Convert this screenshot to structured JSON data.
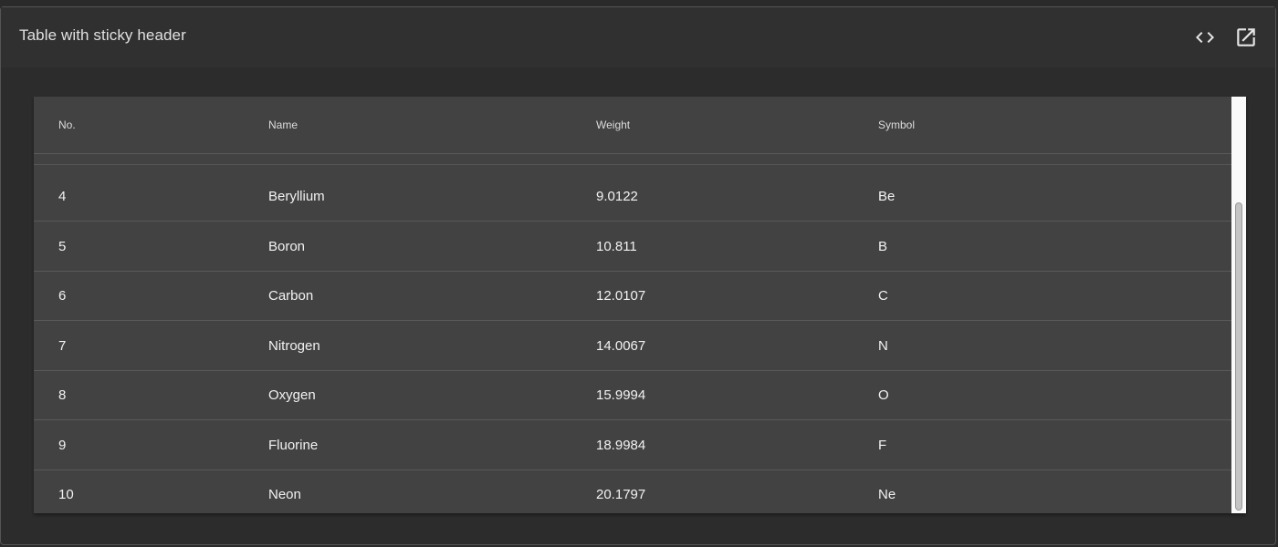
{
  "card": {
    "title": "Table with sticky header"
  },
  "icons": {
    "code": "code-icon",
    "open": "open-in-new-icon"
  },
  "table": {
    "headers": [
      "No.",
      "Name",
      "Weight",
      "Symbol"
    ],
    "rows": [
      [
        "4",
        "Beryllium",
        "9.0122",
        "Be"
      ],
      [
        "5",
        "Boron",
        "10.811",
        "B"
      ],
      [
        "6",
        "Carbon",
        "12.0107",
        "C"
      ],
      [
        "7",
        "Nitrogen",
        "14.0067",
        "N"
      ],
      [
        "8",
        "Oxygen",
        "15.9994",
        "O"
      ],
      [
        "9",
        "Fluorine",
        "18.9984",
        "F"
      ],
      [
        "10",
        "Neon",
        "20.1797",
        "Ne"
      ]
    ]
  }
}
